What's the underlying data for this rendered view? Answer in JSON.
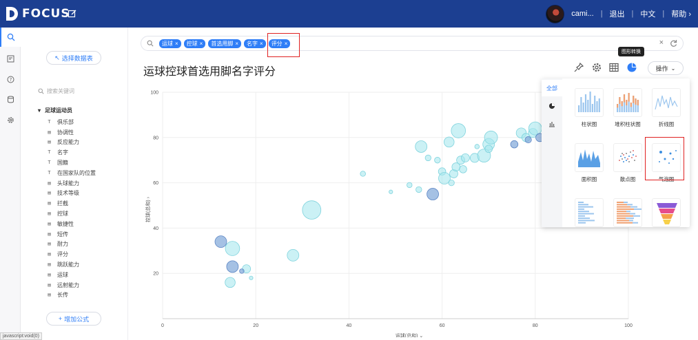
{
  "header": {
    "logo": "FOCUS",
    "username": "cami...",
    "logout": "退出",
    "language": "中文",
    "help": "帮助"
  },
  "sidebar": {
    "select_table": "选择数据表",
    "search_placeholder": "搜索关键词",
    "tree_root": "足球运动员",
    "fields": [
      {
        "label": "俱乐部",
        "type": "T"
      },
      {
        "label": "协调性",
        "type": "#"
      },
      {
        "label": "反应能力",
        "type": "#"
      },
      {
        "label": "名字",
        "type": "T"
      },
      {
        "label": "国籍",
        "type": "T"
      },
      {
        "label": "在国家队的位置",
        "type": "T"
      },
      {
        "label": "头球能力",
        "type": "#"
      },
      {
        "label": "技术等级",
        "type": "#"
      },
      {
        "label": "拦截",
        "type": "#"
      },
      {
        "label": "控球",
        "type": "#"
      },
      {
        "label": "敏捷性",
        "type": "#"
      },
      {
        "label": "短传",
        "type": "#"
      },
      {
        "label": "耐力",
        "type": "#"
      },
      {
        "label": "评分",
        "type": "#"
      },
      {
        "label": "跳跃能力",
        "type": "#"
      },
      {
        "label": "运球",
        "type": "#"
      },
      {
        "label": "远射能力",
        "type": "#"
      },
      {
        "label": "长传",
        "type": "#"
      }
    ],
    "add_formula": "增加公式",
    "status_url": "javascript:void(0)"
  },
  "search": {
    "chips": [
      "运球",
      "控球",
      "首选用脚",
      "名字",
      "评分"
    ]
  },
  "chart_title": "运球控球首选用脚名字评分",
  "toolbar": {
    "tooltip": "图形转换",
    "ops": "操作"
  },
  "popup": {
    "tabs": [
      "全部"
    ],
    "types": [
      {
        "label": "柱状图",
        "icon": "bar-chart-icon"
      },
      {
        "label": "堆积柱状图",
        "icon": "stacked-bar-icon"
      },
      {
        "label": "折线图",
        "icon": "line-chart-icon"
      },
      {
        "label": "面积图",
        "icon": "area-chart-icon"
      },
      {
        "label": "散点图",
        "icon": "scatter-icon"
      },
      {
        "label": "气泡图",
        "icon": "bubble-icon"
      },
      {
        "label": "",
        "icon": "horizontal-bar-icon"
      },
      {
        "label": "",
        "icon": "stacked-horizontal-bar-icon"
      },
      {
        "label": "",
        "icon": "funnel-icon"
      }
    ]
  },
  "colors": {
    "header": "#1c3f91",
    "accent": "#2f7ef7",
    "bubble_light": "#a8e7ee",
    "bubble_dark": "#7fa6d9",
    "highlight": "#e02020"
  },
  "chart_data": {
    "type": "scatter",
    "xlabel": "运球(总和)",
    "ylabel": "控球(总和)",
    "xlim": [
      0,
      100
    ],
    "ylim": [
      0,
      100
    ],
    "xticks": [
      "0",
      "20",
      "40",
      "60",
      "80",
      "100"
    ],
    "yticks": [
      "20",
      "40",
      "60",
      "80",
      "100"
    ],
    "grid": true,
    "points": [
      {
        "x": 15,
        "y": 31,
        "size": 3,
        "dark": false
      },
      {
        "x": 12.5,
        "y": 34,
        "size": 2,
        "dark": true
      },
      {
        "x": 15,
        "y": 23,
        "size": 2,
        "dark": true
      },
      {
        "x": 14.5,
        "y": 16,
        "size": 1.5,
        "dark": false
      },
      {
        "x": 18,
        "y": 22,
        "size": 1,
        "dark": false
      },
      {
        "x": 17,
        "y": 21,
        "size": 0.3,
        "dark": true
      },
      {
        "x": 19,
        "y": 18,
        "size": 0.2,
        "dark": false
      },
      {
        "x": 28,
        "y": 28,
        "size": 2,
        "dark": false
      },
      {
        "x": 32,
        "y": 48,
        "size": 5,
        "dark": false
      },
      {
        "x": 43,
        "y": 64,
        "size": 0.4,
        "dark": false
      },
      {
        "x": 49,
        "y": 56,
        "size": 0.2,
        "dark": false
      },
      {
        "x": 53,
        "y": 59,
        "size": 0.4,
        "dark": false
      },
      {
        "x": 55,
        "y": 57,
        "size": 0.5,
        "dark": false
      },
      {
        "x": 55.5,
        "y": 76,
        "size": 2,
        "dark": false
      },
      {
        "x": 57,
        "y": 71,
        "size": 0.5,
        "dark": false
      },
      {
        "x": 58,
        "y": 55,
        "size": 2,
        "dark": true
      },
      {
        "x": 59,
        "y": 70,
        "size": 0.5,
        "dark": false
      },
      {
        "x": 60,
        "y": 65,
        "size": 0.8,
        "dark": false
      },
      {
        "x": 60.5,
        "y": 62,
        "size": 2,
        "dark": false
      },
      {
        "x": 61.5,
        "y": 78,
        "size": 1.5,
        "dark": false
      },
      {
        "x": 62,
        "y": 60,
        "size": 0.5,
        "dark": false
      },
      {
        "x": 62.5,
        "y": 64,
        "size": 1,
        "dark": false
      },
      {
        "x": 63,
        "y": 67,
        "size": 1,
        "dark": false
      },
      {
        "x": 63.5,
        "y": 83,
        "size": 3,
        "dark": false
      },
      {
        "x": 64,
        "y": 70,
        "size": 1,
        "dark": false
      },
      {
        "x": 64.5,
        "y": 66,
        "size": 0.8,
        "dark": false
      },
      {
        "x": 65,
        "y": 71,
        "size": 1,
        "dark": false
      },
      {
        "x": 67,
        "y": 71,
        "size": 1.2,
        "dark": false
      },
      {
        "x": 67.5,
        "y": 76,
        "size": 0.3,
        "dark": false
      },
      {
        "x": 69,
        "y": 72,
        "size": 2.5,
        "dark": false
      },
      {
        "x": 70,
        "y": 77,
        "size": 2,
        "dark": false
      },
      {
        "x": 70.5,
        "y": 80,
        "size": 2.5,
        "dark": false
      },
      {
        "x": 70,
        "y": 75,
        "size": 0.8,
        "dark": false
      },
      {
        "x": 75.5,
        "y": 77,
        "size": 0.8,
        "dark": true
      },
      {
        "x": 77,
        "y": 82,
        "size": 1.5,
        "dark": false
      },
      {
        "x": 78,
        "y": 80,
        "size": 1,
        "dark": false
      },
      {
        "x": 78.5,
        "y": 79,
        "size": 0.6,
        "dark": true
      },
      {
        "x": 79.5,
        "y": 82,
        "size": 1.2,
        "dark": false
      },
      {
        "x": 80,
        "y": 84,
        "size": 2.5,
        "dark": false
      },
      {
        "x": 81,
        "y": 80,
        "size": 1,
        "dark": true
      }
    ]
  }
}
